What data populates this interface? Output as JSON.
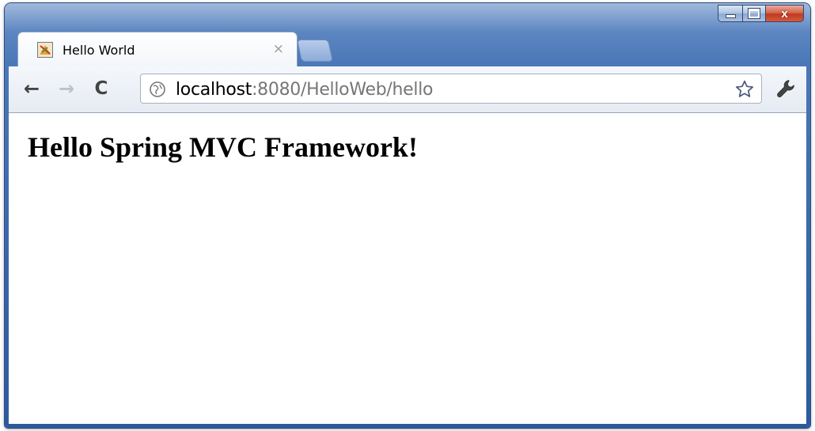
{
  "window": {
    "controls": [
      "minimize",
      "maximize",
      "close"
    ]
  },
  "tabs": [
    {
      "title": "Hello World",
      "close_glyph": "×",
      "favicon": "document-icon",
      "active": true
    }
  ],
  "toolbar": {
    "back_glyph": "←",
    "forward_glyph": "→",
    "reload_glyph": "C",
    "url_host": "localhost",
    "url_rest": ":8080/HelloWeb/hello",
    "icons": [
      "back-arrow-icon",
      "forward-arrow-icon",
      "reload-icon",
      "globe-icon",
      "star-icon",
      "wrench-icon"
    ]
  },
  "page": {
    "heading": "Hello Spring MVC Framework!"
  },
  "colors": {
    "frame": "#4b78b8",
    "close_button": "#c23a1e",
    "url_dim": "#767676"
  }
}
